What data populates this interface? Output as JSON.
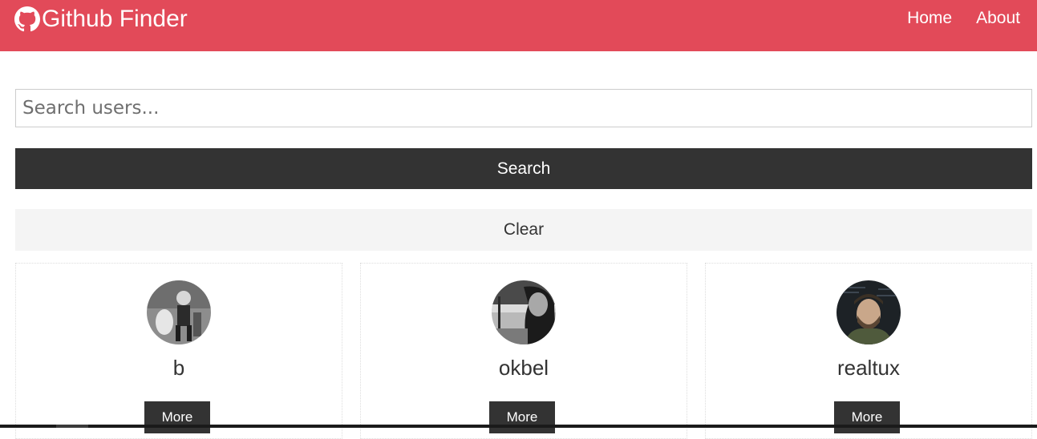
{
  "navbar": {
    "brand_icon": "github-icon",
    "title": "Github Finder",
    "links": [
      {
        "label": "Home"
      },
      {
        "label": "About"
      }
    ],
    "background": "#e24a59"
  },
  "search": {
    "placeholder": "Search users...",
    "value": "",
    "search_label": "Search",
    "clear_label": "Clear"
  },
  "users": [
    {
      "login": "b",
      "more_label": "More",
      "avatar": "avatar-photo"
    },
    {
      "login": "okbel",
      "more_label": "More",
      "avatar": "avatar-photo"
    },
    {
      "login": "realtux",
      "more_label": "More",
      "avatar": "avatar-photo"
    }
  ],
  "colors": {
    "dark": "#333333",
    "light": "#f4f4f4",
    "primary": "#e24a59"
  }
}
